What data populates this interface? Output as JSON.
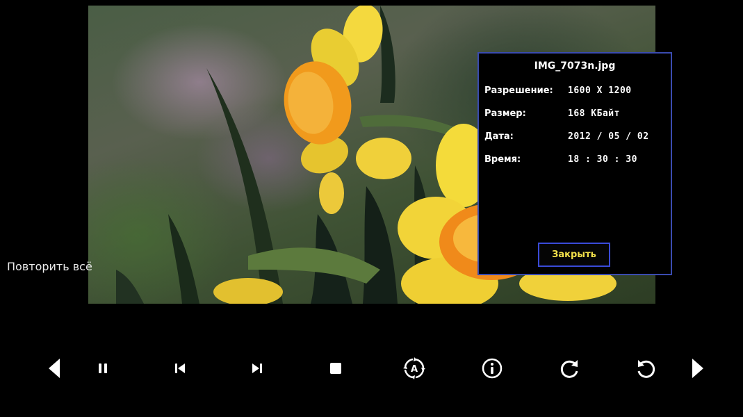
{
  "info": {
    "filename": "IMG_7073n.jpg",
    "rows": [
      {
        "label": "Разрешение:",
        "value": "1600 X 1200"
      },
      {
        "label": "Размер:",
        "value": "168 КБайт"
      },
      {
        "label": "Дата:",
        "value": "2012 / 05 / 02"
      },
      {
        "label": "Время:",
        "value": "18 : 30 : 30"
      }
    ],
    "close_label": "Закрыть"
  },
  "repeat_mode": "Повторить всё",
  "controls": [
    "prev-arrow-icon",
    "pause-icon",
    "skip-previous-icon",
    "skip-next-icon",
    "stop-icon",
    "auto-rotate-icon",
    "info-icon",
    "rotate-clockwise-icon",
    "rotate-counterclockwise-icon",
    "next-arrow-icon"
  ],
  "colors": {
    "dialog_border": "#3a4bb0",
    "close_text": "#f2e04a",
    "background": "#000000"
  }
}
